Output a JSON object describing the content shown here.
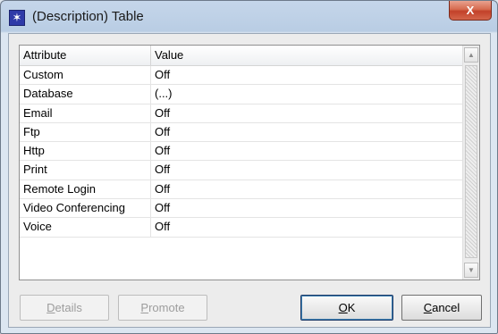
{
  "window": {
    "title": "(Description) Table",
    "close_glyph": "X",
    "app_icon_glyph": "✶"
  },
  "table": {
    "headers": {
      "attribute": "Attribute",
      "value": "Value"
    },
    "rows": [
      {
        "attribute": "Custom",
        "value": "Off"
      },
      {
        "attribute": "Database",
        "value": "(...)"
      },
      {
        "attribute": "Email",
        "value": "Off"
      },
      {
        "attribute": "Ftp",
        "value": "Off"
      },
      {
        "attribute": "Http",
        "value": "Off"
      },
      {
        "attribute": "Print",
        "value": "Off"
      },
      {
        "attribute": "Remote Login",
        "value": "Off"
      },
      {
        "attribute": "Video Conferencing",
        "value": "Off"
      },
      {
        "attribute": "Voice",
        "value": "Off"
      }
    ]
  },
  "buttons": {
    "details": {
      "mnemonic": "D",
      "rest": "etails",
      "enabled": false
    },
    "promote": {
      "mnemonic": "P",
      "rest": "romote",
      "enabled": false
    },
    "ok": {
      "mnemonic": "O",
      "rest": "K",
      "enabled": true
    },
    "cancel": {
      "mnemonic": "C",
      "rest": "ancel",
      "enabled": true
    }
  },
  "icons": {
    "app": "star-icon",
    "close": "close-icon",
    "scroll_up": "chevron-up-icon",
    "scroll_down": "chevron-down-icon"
  },
  "colors": {
    "title_bar": "#c5d6ea",
    "close_button": "#c2412a",
    "app_icon": "#2f3aa8"
  }
}
